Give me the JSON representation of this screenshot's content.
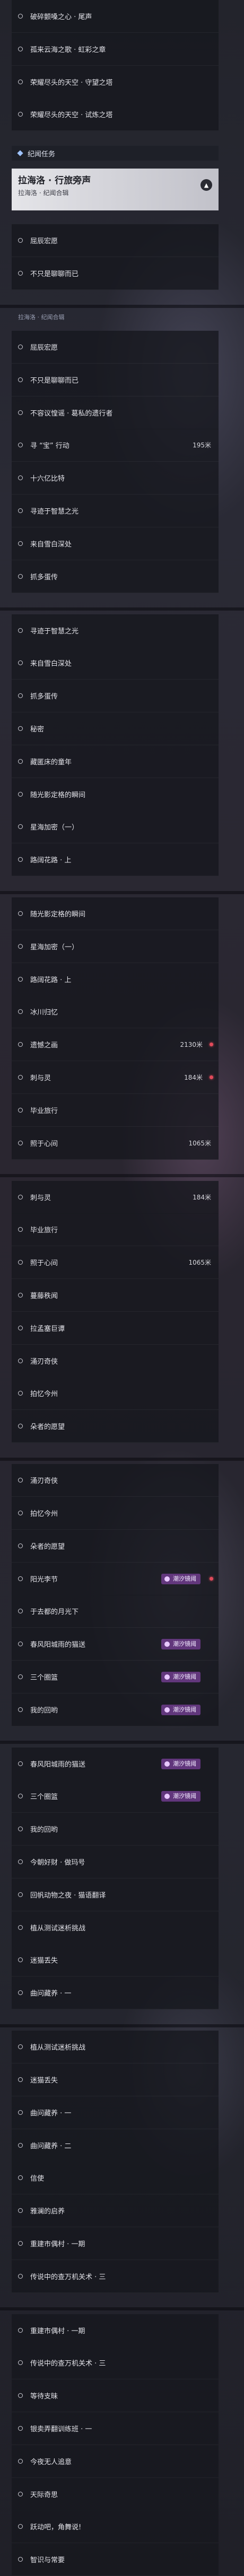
{
  "rows": [
    {
      "label": "破碎颤嗓之心 · 尾声"
    },
    {
      "label": "孤来云海之歌 · 虹彩之章"
    },
    {
      "label": "荣耀尽头的天空 · 守望之塔"
    },
    {
      "label": "荣耀尽头的天空 · 试炼之塔"
    },
    {
      "label": "纪闻任务"
    },
    {
      "label": "拉海洛 · 行旅旁声",
      "sub": "拉海洛 · 纪闻合辑"
    },
    {
      "label": "屈辰宏愿"
    },
    {
      "label": "不只是聊聊而已"
    },
    {
      "label": "拉海洛 · 纪闻合辑"
    },
    {
      "label": "屈辰宏愿"
    },
    {
      "label": "不只是聊聊而已"
    },
    {
      "label": "不容议惶谣 · 葛私的遗行者"
    },
    {
      "label": "寻 “宝” 行动",
      "dist": "195米"
    },
    {
      "label": "十六亿比特"
    },
    {
      "label": "寻迹于智慧之光"
    },
    {
      "label": "来自雪白深处"
    },
    {
      "label": "抓多蛋传"
    },
    {
      "label": "寻迹于智慧之光"
    },
    {
      "label": "来自雪白深处"
    },
    {
      "label": "抓多蛋传"
    },
    {
      "label": "秘密"
    },
    {
      "label": "藏匿床的童年"
    },
    {
      "label": "随光影定格的瞬间"
    },
    {
      "label": "星海加密（一）"
    },
    {
      "label": "路阔花路 · 上"
    },
    {
      "label": "随光影定格的瞬间"
    },
    {
      "label": "星海加密（一）"
    },
    {
      "label": "路阔花路 · 上"
    },
    {
      "label": "冰川归忆"
    },
    {
      "label": "遗憾之画",
      "dist": "2130米",
      "dot": true
    },
    {
      "label": "刺与灵",
      "dist": "184米",
      "dot": true
    },
    {
      "label": "毕业旅行"
    },
    {
      "label": "照于心间",
      "dist": "1065米"
    },
    {
      "label": "刺与灵",
      "dist": "184米"
    },
    {
      "label": "毕业旅行"
    },
    {
      "label": "照于心间",
      "dist": "1065米"
    },
    {
      "label": "蔓藤秩闻"
    },
    {
      "label": "拉孟塞巨谭"
    },
    {
      "label": "涌刃奇侠"
    },
    {
      "label": "拍忆今州"
    },
    {
      "label": "朵者的愿望"
    },
    {
      "label": "涌刃奇侠"
    },
    {
      "label": "拍忆今州"
    },
    {
      "label": "朵者的愿望"
    },
    {
      "label": "阳光李节",
      "tag": "潮汐镜阈",
      "dot": true
    },
    {
      "label": "于去都的月光下"
    },
    {
      "label": "春风阳城雨的猫送",
      "tag": "潮汐镜阈"
    },
    {
      "label": "三个圈篮",
      "tag": "潮汐镜阈"
    },
    {
      "label": "我的回哟",
      "tag": "潮汐镜阈"
    },
    {
      "label": "春风阳城雨的猫送",
      "tag": "潮汐镜阈"
    },
    {
      "label": "三个圈篮",
      "tag": "潮汐镜阈"
    },
    {
      "label": "我的回哟"
    },
    {
      "label": "今朝好财 · 做玛号"
    },
    {
      "label": "回帆动物之夜 · 猫语翻译"
    },
    {
      "label": "植从测试迷析挑战"
    },
    {
      "label": "迷猫丢失"
    },
    {
      "label": "曲问藏养 · 一"
    },
    {
      "label": "植从测试迷析挑战"
    },
    {
      "label": "迷猫丢失"
    },
    {
      "label": "曲问藏养 · 一"
    },
    {
      "label": "曲问藏养 · 二"
    },
    {
      "label": "信使"
    },
    {
      "label": "雅澜的启养"
    },
    {
      "label": "重建市偶村 · 一期"
    },
    {
      "label": "传说中的查万机关术 · 三"
    },
    {
      "label": "重建市偶村 · 一期"
    },
    {
      "label": "传说中的查万机关术 · 三"
    },
    {
      "label": "等待支昧"
    },
    {
      "label": "银卖弄翻训练班 · 一"
    },
    {
      "label": "今夜无人追意"
    },
    {
      "label": "天际奇思"
    },
    {
      "label": "跃动吧，角舞说!"
    },
    {
      "label": "智识与常要"
    }
  ]
}
